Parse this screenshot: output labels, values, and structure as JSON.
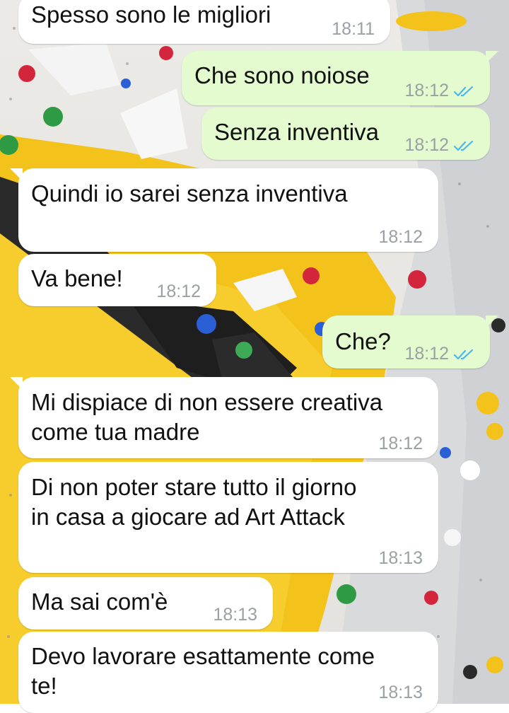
{
  "chat": {
    "messages": [
      {
        "direction": "in",
        "text": "Spesso sono le migliori",
        "time": "18:11"
      },
      {
        "direction": "out",
        "text": "Che sono noiose",
        "time": "18:12",
        "status": "read"
      },
      {
        "direction": "out",
        "text": "Senza inventiva",
        "time": "18:12",
        "status": "read"
      },
      {
        "direction": "in",
        "text": "Quindi io sarei senza inventiva",
        "time": "18:12"
      },
      {
        "direction": "in",
        "text": "Va bene!",
        "time": "18:12"
      },
      {
        "direction": "out",
        "text": "Che?",
        "time": "18:12",
        "status": "read"
      },
      {
        "direction": "in",
        "text": "Mi dispiace di non essere creativa\ncome tua madre",
        "time": "18:12"
      },
      {
        "direction": "in",
        "text": "Di non poter stare tutto il giorno\nin casa a giocare ad Art Attack",
        "time": "18:13"
      },
      {
        "direction": "in",
        "text": "Ma sai com'è",
        "time": "18:13"
      },
      {
        "direction": "in",
        "text": "Devo lavorare esattamente come\nte!",
        "time": "18:13"
      }
    ]
  },
  "colors": {
    "incoming_bubble": "#ffffff",
    "outgoing_bubble": "#e3fbce",
    "timestamp": "#9aa0a3",
    "read_ticks": "#4fb6ec",
    "wall_yellow": "#f5c518"
  },
  "icons": {
    "read_receipt": "double-check-icon"
  }
}
